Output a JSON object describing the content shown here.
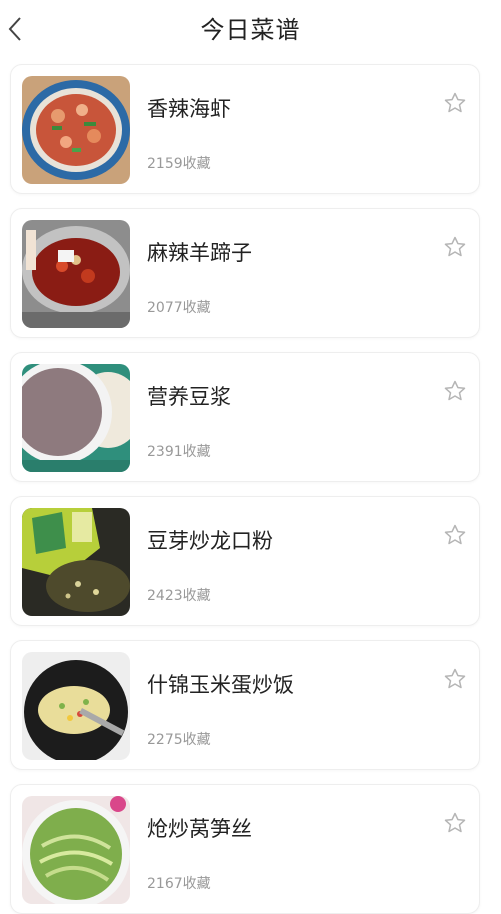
{
  "header": {
    "title": "今日菜谱",
    "back_icon": "chevron-left-icon"
  },
  "recipes": [
    {
      "name": "香辣海虾",
      "favorites": "2159收藏"
    },
    {
      "name": "麻辣羊蹄子",
      "favorites": "2077收藏"
    },
    {
      "name": "营养豆浆",
      "favorites": "2391收藏"
    },
    {
      "name": "豆芽炒龙口粉",
      "favorites": "2423收藏"
    },
    {
      "name": "什锦玉米蛋炒饭",
      "favorites": "2275收藏"
    },
    {
      "name": "炝炒莴笋丝",
      "favorites": "2167收藏"
    }
  ],
  "colors": {
    "text": "#222222",
    "muted": "#999999",
    "border": "#eeeeee",
    "star": "#bbbbbb"
  }
}
